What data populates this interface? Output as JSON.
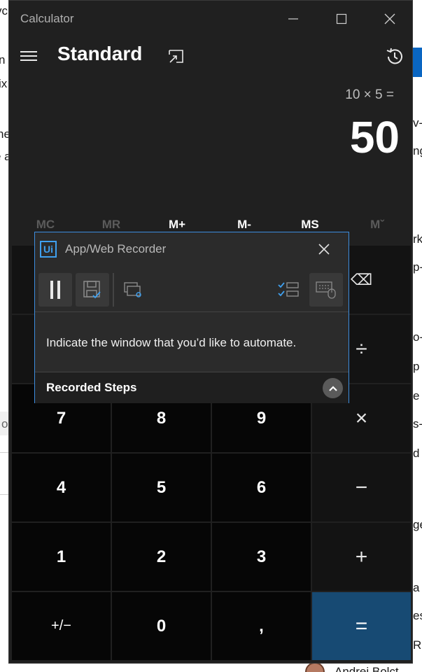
{
  "background": {
    "fragments": [
      "vc",
      "n",
      "ix",
      "he",
      "e a",
      "v-",
      "ng",
      "rk",
      "p-",
      "o-",
      "p",
      "e",
      "s-",
      "d",
      "ge",
      "a",
      "es",
      "Ro",
      "o",
      "Andrei Bolct"
    ]
  },
  "calculator": {
    "window_title": "Calculator",
    "mode_title": "Standard",
    "expression": "10 × 5 =",
    "result": "50",
    "memory_buttons": [
      "MC",
      "MR",
      "M+",
      "M-",
      "MS",
      "Mˇ"
    ],
    "keys": {
      "backspace": "⌫",
      "divide": "÷",
      "multiply": "×",
      "subtract": "−",
      "add": "+",
      "equals": "=",
      "seven": "7",
      "eight": "8",
      "nine": "9",
      "four": "4",
      "five": "5",
      "six": "6",
      "one": "1",
      "two": "2",
      "three": "3",
      "negate": "+/−",
      "zero": "0",
      "decimal": ","
    }
  },
  "recorder": {
    "logo_text": "Ui",
    "title": "App/Web Recorder",
    "message": "Indicate the window that you’d like to automate.",
    "steps_label": "Recorded Steps"
  }
}
